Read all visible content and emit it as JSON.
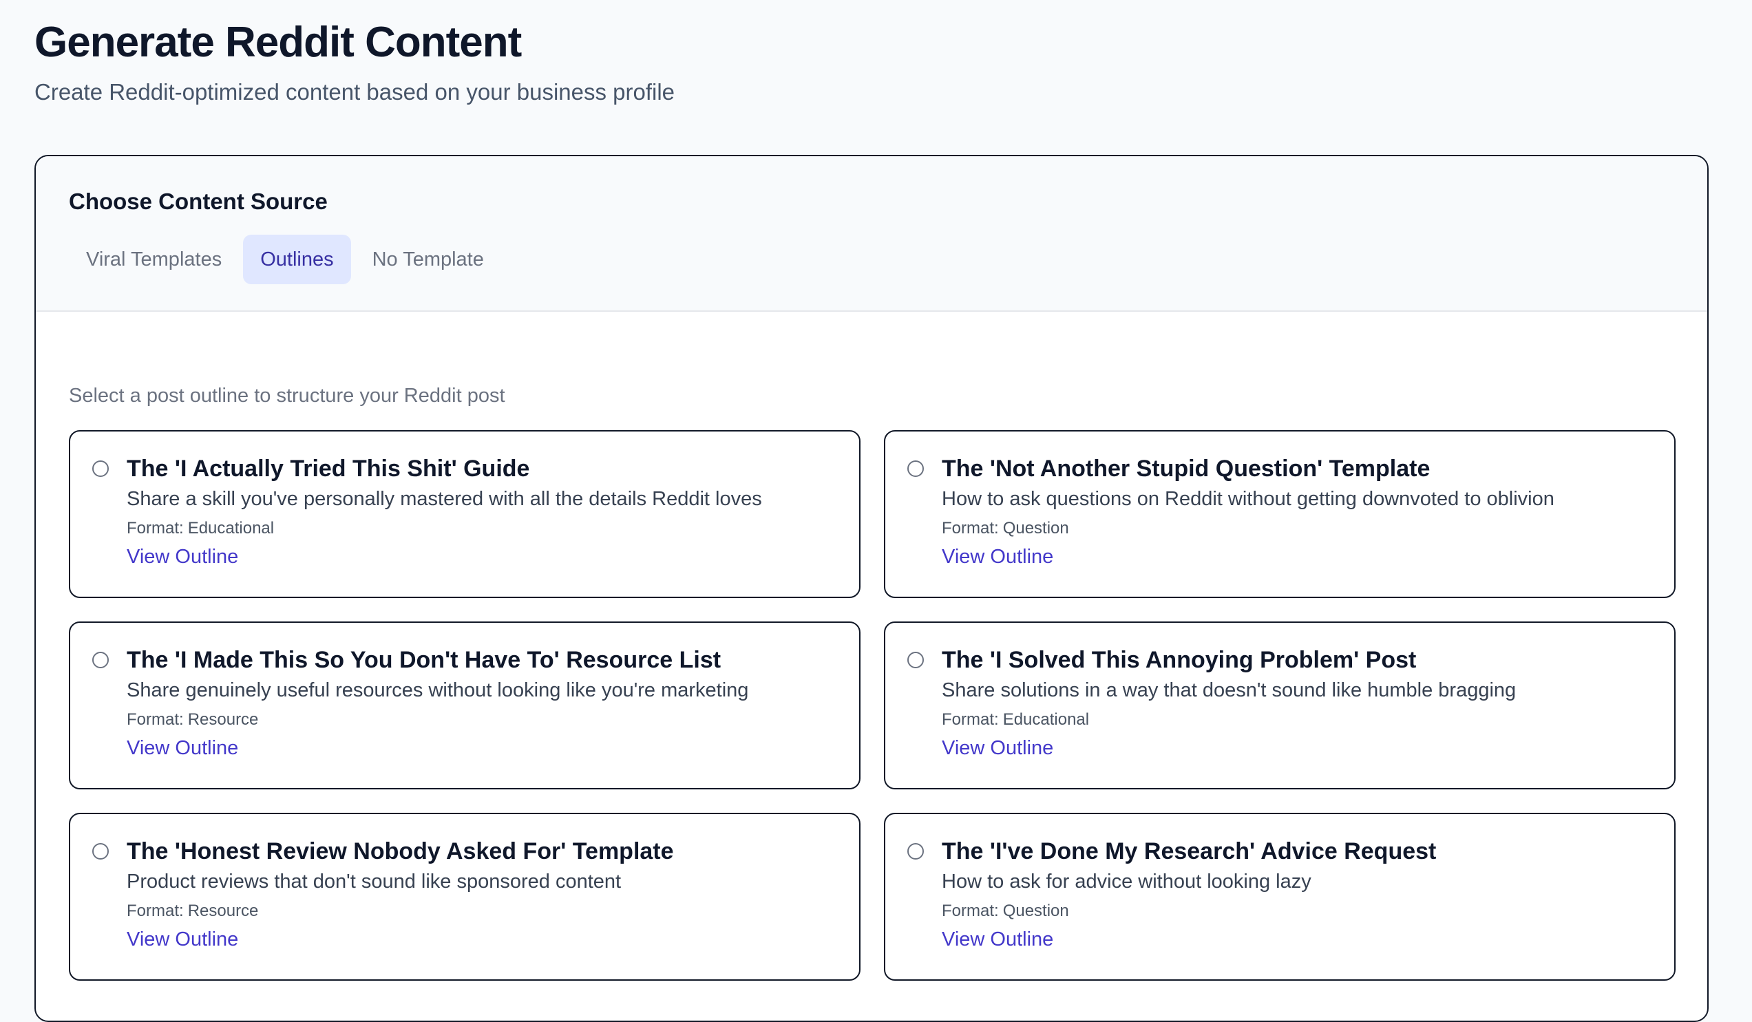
{
  "page": {
    "title": "Generate Reddit Content",
    "subtitle": "Create Reddit-optimized content based on your business profile"
  },
  "source": {
    "title": "Choose Content Source",
    "tabs": [
      {
        "label": "Viral Templates",
        "active": false
      },
      {
        "label": "Outlines",
        "active": true
      },
      {
        "label": "No Template",
        "active": false
      }
    ]
  },
  "outlines": {
    "hint": "Select a post outline to structure your Reddit post",
    "format_prefix": "Format:",
    "link_label": "View Outline",
    "items": [
      {
        "title": "The 'I Actually Tried This Shit' Guide",
        "description": "Share a skill you've personally mastered with all the details Reddit loves",
        "format": "Educational"
      },
      {
        "title": "The 'Not Another Stupid Question' Template",
        "description": "How to ask questions on Reddit without getting downvoted to oblivion",
        "format": "Question"
      },
      {
        "title": "The 'I Made This So You Don't Have To' Resource List",
        "description": "Share genuinely useful resources without looking like you're marketing",
        "format": "Resource"
      },
      {
        "title": "The 'I Solved This Annoying Problem' Post",
        "description": "Share solutions in a way that doesn't sound like humble bragging",
        "format": "Educational"
      },
      {
        "title": "The 'Honest Review Nobody Asked For' Template",
        "description": "Product reviews that don't sound like sponsored content",
        "format": "Resource"
      },
      {
        "title": "The 'I've Done My Research' Advice Request",
        "description": "How to ask for advice without looking lazy",
        "format": "Question"
      }
    ]
  },
  "colors": {
    "accent": "#4338ca",
    "active_tab_bg": "#e0e7ff",
    "border": "#111827",
    "page_bg": "#f8fafc"
  }
}
